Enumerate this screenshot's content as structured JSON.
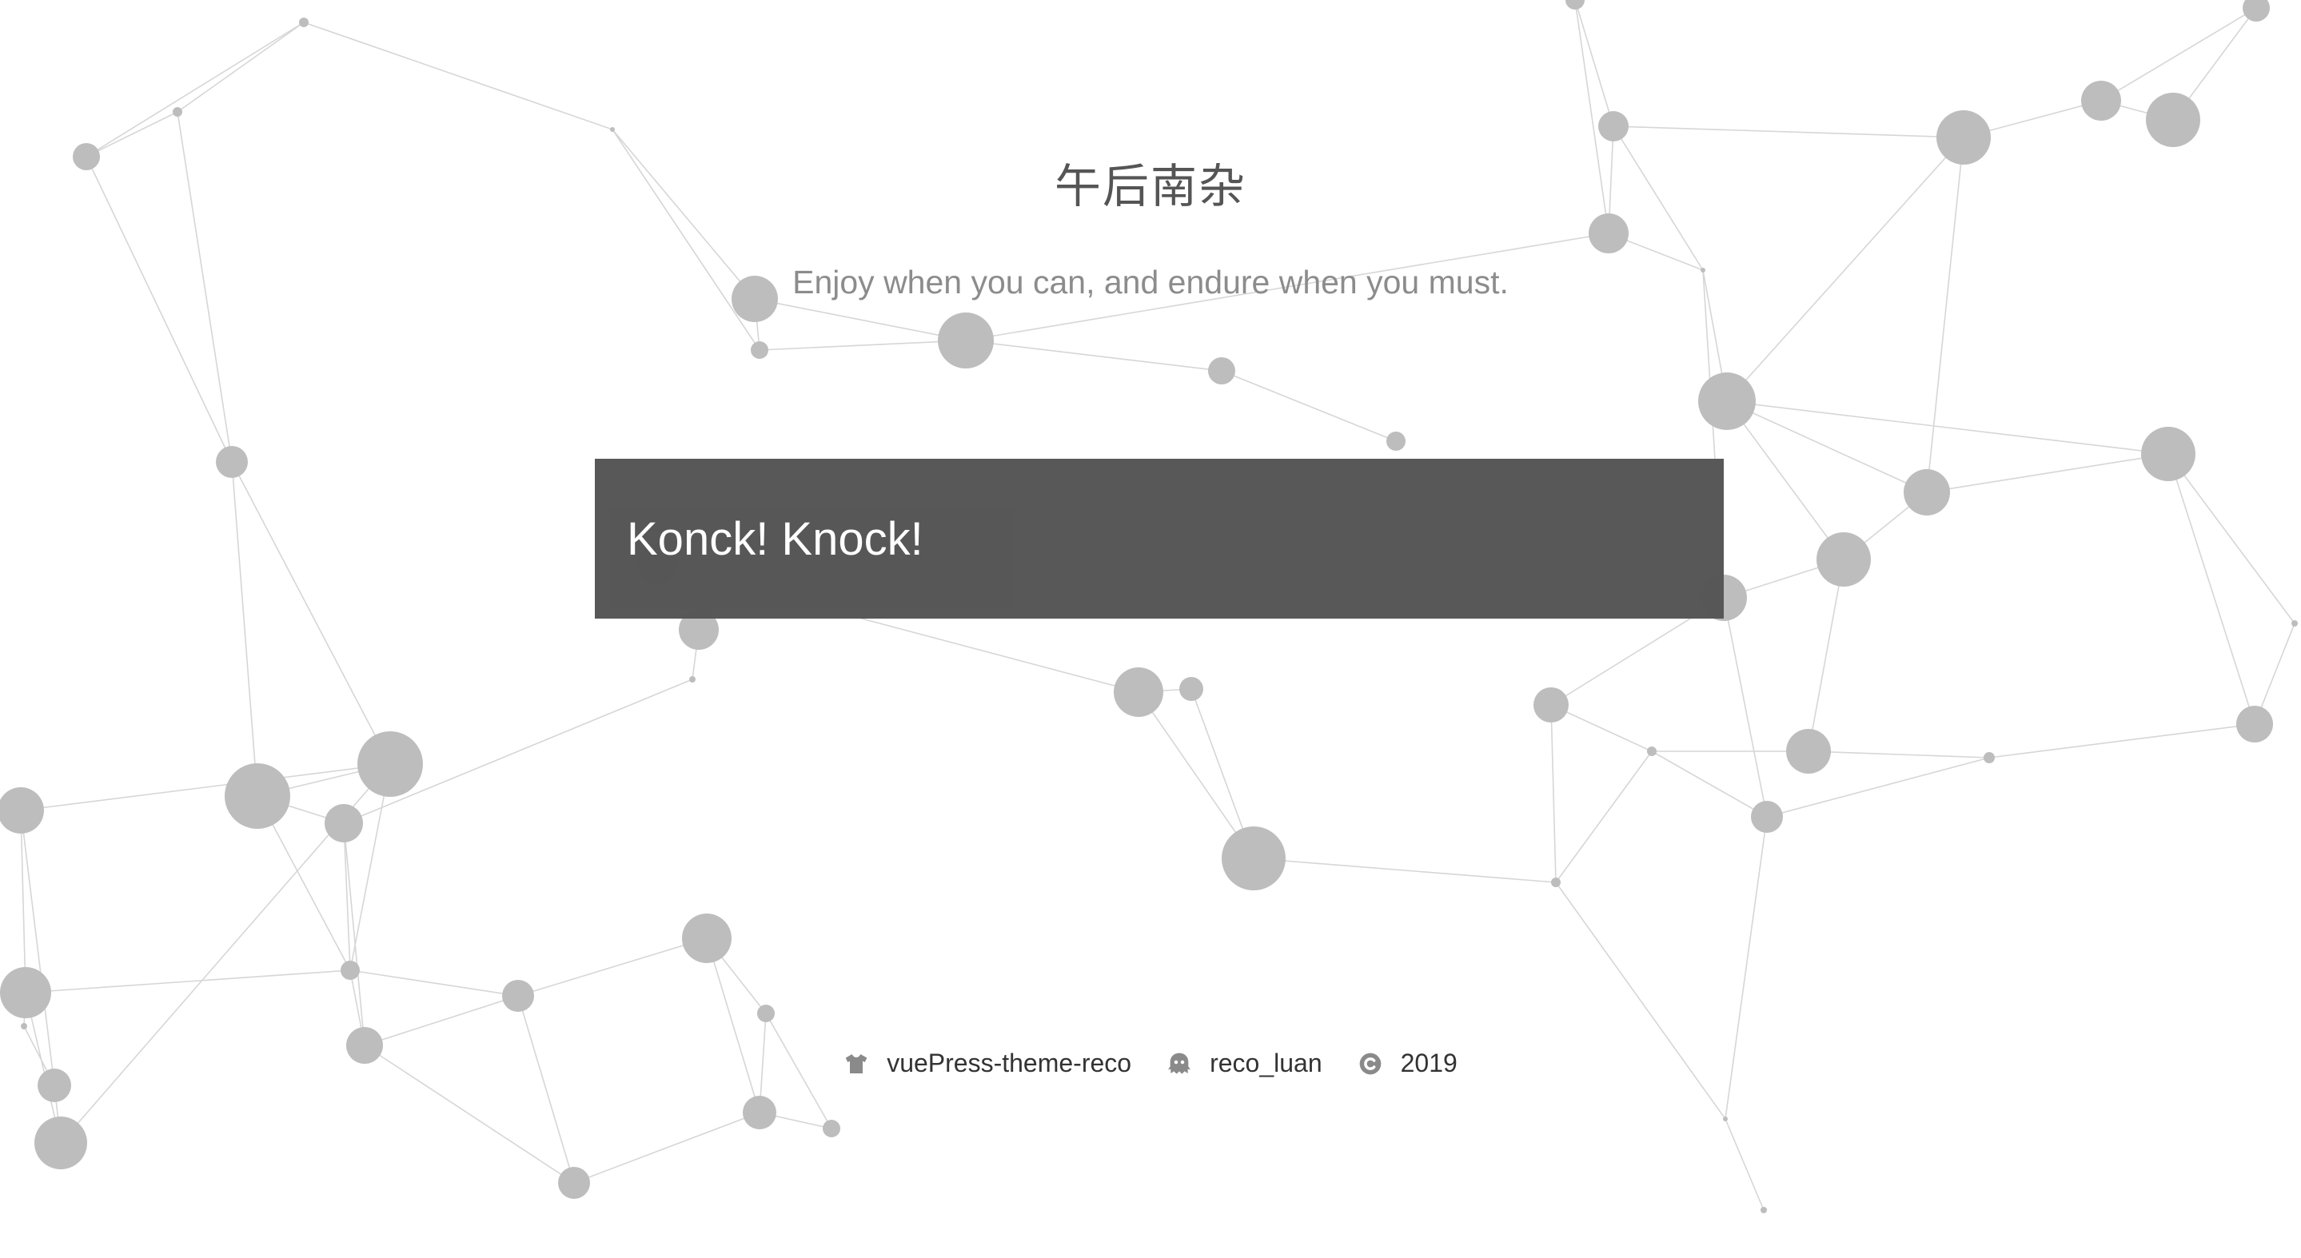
{
  "header": {
    "title": "午后南杂",
    "tagline": "Enjoy when you can, and endure when you must."
  },
  "password": {
    "text": "Konck! Knock!"
  },
  "footer": {
    "theme": {
      "icon": "shirt-icon",
      "label": "vuePress-theme-reco"
    },
    "author": {
      "icon": "ghost-icon",
      "label": "reco_luan"
    },
    "copyright": {
      "icon": "copyright-icon",
      "label": "2019"
    }
  },
  "colors": {
    "background": "#ffffff",
    "node": "#bdbdbd",
    "line": "#d6d6d6",
    "panel": "#555555",
    "title": "#555555",
    "tagline": "#8c8c8c",
    "footer_text": "#333333",
    "footer_icon": "#8a8a8a"
  }
}
